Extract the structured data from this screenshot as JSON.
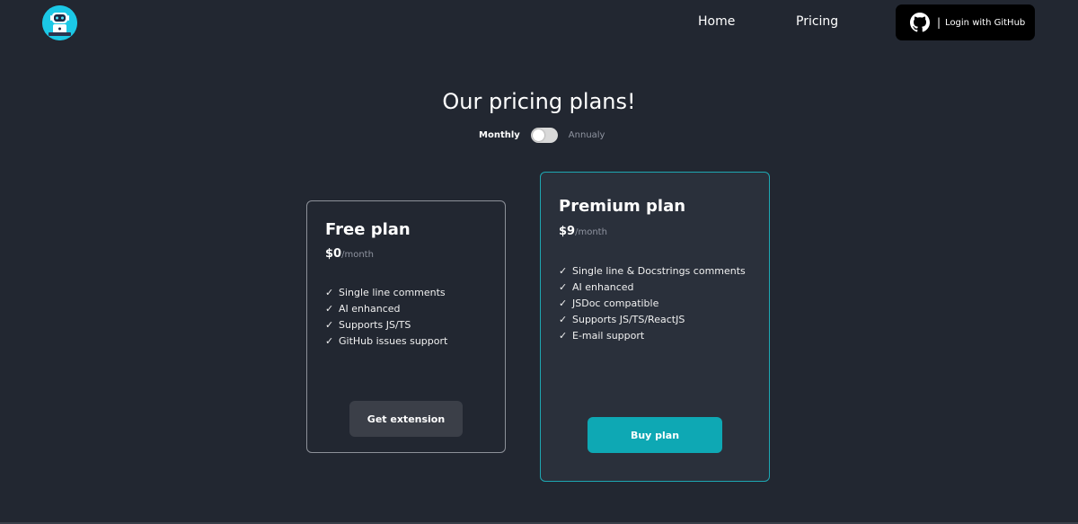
{
  "nav": {
    "logo_icon": "robot-icon",
    "home_label": "Home",
    "pricing_label": "Pricing",
    "github_separator": "|",
    "github_label": "Login with GitHub",
    "github_icon": "github-icon"
  },
  "header": {
    "title": "Our pricing plans!",
    "toggle_left": "Monthly",
    "toggle_right": "Annualy"
  },
  "plans": [
    {
      "name": "Free plan",
      "price": "$0",
      "period": "/month",
      "features": [
        "Single line comments",
        "AI enhanced",
        "Supports JS/TS",
        "GitHub issues support"
      ],
      "button_label": "Get extension"
    },
    {
      "name": "Premium plan",
      "price": "$9",
      "period": "/month",
      "features": [
        "Single line & Docstrings comments",
        "AI enhanced",
        "JSDoc compatible",
        "Supports JS/TS/ReactJS",
        "E-mail support"
      ],
      "button_label": "Buy plan"
    }
  ],
  "check_glyph": "✓",
  "colors": {
    "background": "#222731",
    "accent": "#0ea8b4",
    "premium_border": "#1ea7b2",
    "github_button": "#000000",
    "logo": "#1bc8e6"
  }
}
